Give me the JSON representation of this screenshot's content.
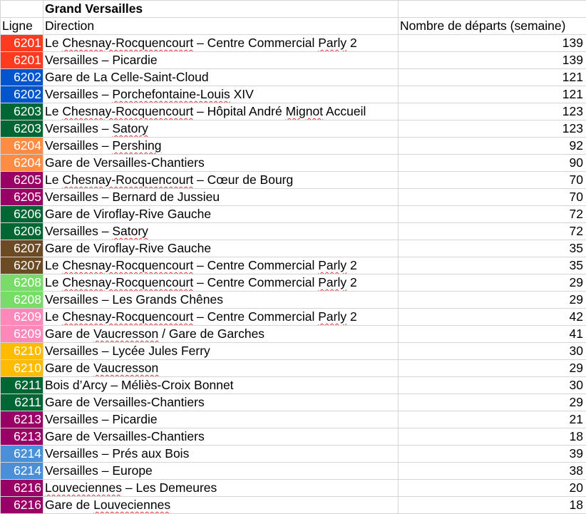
{
  "sheet": {
    "title": "Grand Versailles",
    "headers": {
      "line": "Ligne",
      "direction": "Direction",
      "departures": "Nombre de départs (semaine)"
    },
    "rows": [
      {
        "line": "6201",
        "color": "#ff3a1e",
        "direction": [
          {
            "t": "Le "
          },
          {
            "t": "Chesnay-Rocquencourt",
            "sq": true
          },
          {
            "t": " – Centre Commercial "
          },
          {
            "t": "Parly",
            "sq": true
          },
          {
            "t": " 2"
          }
        ],
        "departures": "139"
      },
      {
        "line": "6201",
        "color": "#ff3a1e",
        "direction": [
          {
            "t": "Versailles – Picardie"
          }
        ],
        "departures": "139"
      },
      {
        "line": "6202",
        "color": "#0055cc",
        "direction": [
          {
            "t": "Gare de La Celle-Saint-Cloud"
          }
        ],
        "departures": "121"
      },
      {
        "line": "6202",
        "color": "#0055cc",
        "direction": [
          {
            "t": "Versailles – "
          },
          {
            "t": "Porchefontaine-Louis",
            "sq": true
          },
          {
            "t": " XIV"
          }
        ],
        "departures": "121"
      },
      {
        "line": "6203",
        "color": "#006633",
        "direction": [
          {
            "t": "Le "
          },
          {
            "t": "Chesnay-Rocquencourt",
            "sq": true
          },
          {
            "t": " – Hôpital André "
          },
          {
            "t": "Mignot",
            "sq": true
          },
          {
            "t": " Accueil"
          }
        ],
        "departures": "123"
      },
      {
        "line": "6203",
        "color": "#006633",
        "direction": [
          {
            "t": "Versailles – "
          },
          {
            "t": "Satory",
            "sq": true
          }
        ],
        "departures": "123"
      },
      {
        "line": "6204",
        "color": "#ff8c42",
        "direction": [
          {
            "t": "Versailles – "
          },
          {
            "t": "Pershing",
            "sq": true
          }
        ],
        "departures": "92"
      },
      {
        "line": "6204",
        "color": "#ff8c42",
        "direction": [
          {
            "t": "Gare de Versailles-Chantiers"
          }
        ],
        "departures": "90"
      },
      {
        "line": "6205",
        "color": "#990066",
        "direction": [
          {
            "t": "Le "
          },
          {
            "t": "Chesnay-Rocquencourt",
            "sq": true
          },
          {
            "t": " – Cœur de Bourg"
          }
        ],
        "departures": "70"
      },
      {
        "line": "6205",
        "color": "#990066",
        "direction": [
          {
            "t": "Versailles – Bernard de Jussieu"
          }
        ],
        "departures": "70"
      },
      {
        "line": "6206",
        "color": "#006633",
        "direction": [
          {
            "t": "Gare de Viroflay-Rive Gauche"
          }
        ],
        "departures": "72"
      },
      {
        "line": "6206",
        "color": "#006633",
        "direction": [
          {
            "t": "Versailles – "
          },
          {
            "t": "Satory",
            "sq": true
          }
        ],
        "departures": "72"
      },
      {
        "line": "6207",
        "color": "#6b4a24",
        "direction": [
          {
            "t": "Gare de Viroflay-Rive Gauche"
          }
        ],
        "departures": "35"
      },
      {
        "line": "6207",
        "color": "#6b4a24",
        "direction": [
          {
            "t": "Le "
          },
          {
            "t": "Chesnay-Rocquencourt",
            "sq": true
          },
          {
            "t": " – Centre Commercial "
          },
          {
            "t": "Parly",
            "sq": true
          },
          {
            "t": " 2"
          }
        ],
        "departures": "35"
      },
      {
        "line": "6208",
        "color": "#77dd66",
        "direction": [
          {
            "t": "Le "
          },
          {
            "t": "Chesnay-Rocquencourt",
            "sq": true
          },
          {
            "t": " – Centre Commercial "
          },
          {
            "t": "Parly",
            "sq": true
          },
          {
            "t": " 2"
          }
        ],
        "departures": "29"
      },
      {
        "line": "6208",
        "color": "#77dd66",
        "direction": [
          {
            "t": "Versailles – Les Grands Chênes"
          }
        ],
        "departures": "29"
      },
      {
        "line": "6209",
        "color": "#ff88bb",
        "direction": [
          {
            "t": "Le "
          },
          {
            "t": "Chesnay-Rocquencourt",
            "sq": true
          },
          {
            "t": " – Centre Commercial "
          },
          {
            "t": "Parly",
            "sq": true
          },
          {
            "t": " 2"
          }
        ],
        "departures": "42"
      },
      {
        "line": "6209",
        "color": "#ff88bb",
        "direction": [
          {
            "t": "Gare de "
          },
          {
            "t": "Vaucresson",
            "sq": true
          },
          {
            "t": " / Gare de Garches"
          }
        ],
        "departures": "41"
      },
      {
        "line": "6210",
        "color": "#ffbb00",
        "direction": [
          {
            "t": "Versailles – Lycée Jules Ferry"
          }
        ],
        "departures": "30"
      },
      {
        "line": "6210",
        "color": "#ffbb00",
        "direction": [
          {
            "t": "Gare de "
          },
          {
            "t": "Vaucresson",
            "sq": true
          }
        ],
        "departures": "29"
      },
      {
        "line": "6211",
        "color": "#006633",
        "direction": [
          {
            "t": "Bois d’Arcy – Méliès-Croix Bonnet"
          }
        ],
        "departures": "30"
      },
      {
        "line": "6211",
        "color": "#006633",
        "direction": [
          {
            "t": "Gare de Versailles-Chantiers"
          }
        ],
        "departures": "29"
      },
      {
        "line": "6213",
        "color": "#990066",
        "direction": [
          {
            "t": "Versailles – Picardie"
          }
        ],
        "departures": "21"
      },
      {
        "line": "6213",
        "color": "#990066",
        "direction": [
          {
            "t": "Gare de Versailles-Chantiers"
          }
        ],
        "departures": "18"
      },
      {
        "line": "6214",
        "color": "#4a90d9",
        "direction": [
          {
            "t": "Versailles – Prés aux Bois"
          }
        ],
        "departures": "39"
      },
      {
        "line": "6214",
        "color": "#4a90d9",
        "direction": [
          {
            "t": "Versailles – Europe"
          }
        ],
        "departures": "38"
      },
      {
        "line": "6216",
        "color": "#990066",
        "direction": [
          {
            "t": "Louveciennes",
            "sq": true
          },
          {
            "t": " – Les Demeures"
          }
        ],
        "departures": "20"
      },
      {
        "line": "6216",
        "color": "#990066",
        "direction": [
          {
            "t": "Gare de "
          },
          {
            "t": "Louveciennes",
            "sq": true
          }
        ],
        "departures": "18"
      }
    ]
  }
}
